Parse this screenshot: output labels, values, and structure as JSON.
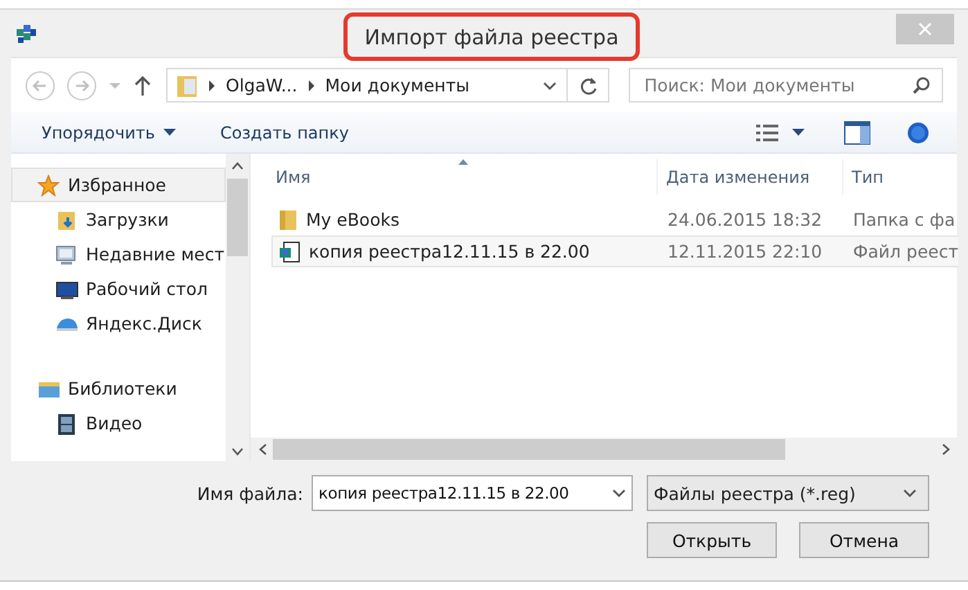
{
  "window": {
    "title": "Импорт файла реестра",
    "title_highlighted": true
  },
  "navigation": {
    "path": [
      "OlgaW...",
      "Мои документы"
    ],
    "search": {
      "placeholder": "Поиск: Мои документы"
    }
  },
  "toolbar": {
    "buttons": [
      {
        "label": "Упорядочить",
        "dropdown": true
      },
      {
        "label": "Создать папку",
        "dropdown": false
      }
    ]
  },
  "sidebar": {
    "items": [
      {
        "label": "Избранное",
        "kind": "star",
        "selected": true,
        "children": [
          {
            "label": "Загрузки",
            "kind": "downloads",
            "selected": false
          },
          {
            "label": "Недавние мест",
            "kind": "recent",
            "selected": false
          },
          {
            "label": "Рабочий стол",
            "kind": "desktop",
            "selected": false
          },
          {
            "label": "Яндекс.Диск",
            "kind": "cloud",
            "selected": false
          }
        ]
      },
      {
        "label": "Библиотеки",
        "kind": "library",
        "selected": false,
        "children": [
          {
            "label": "Видео",
            "kind": "video",
            "selected": false
          }
        ]
      }
    ]
  },
  "table": {
    "columns": [
      "Имя",
      "Дата изменения",
      "Тип"
    ],
    "rows": [
      {
        "kind": "folder",
        "name": "My eBooks",
        "date": "24.06.2015 18:32",
        "type": "Папка с фа",
        "selected": false
      },
      {
        "kind": "registry",
        "name": "копия реестра12.11.15 в 22.00",
        "date": "12.11.2015 22:10",
        "type": "Файл реест",
        "selected": true
      }
    ]
  },
  "footer": {
    "filename_label": "Имя файла:",
    "filename": "копия реестра12.11.15 в 22.00",
    "filter": "Файлы реестра (*.reg)",
    "buttons": [
      "Открыть",
      "Отмена"
    ]
  }
}
